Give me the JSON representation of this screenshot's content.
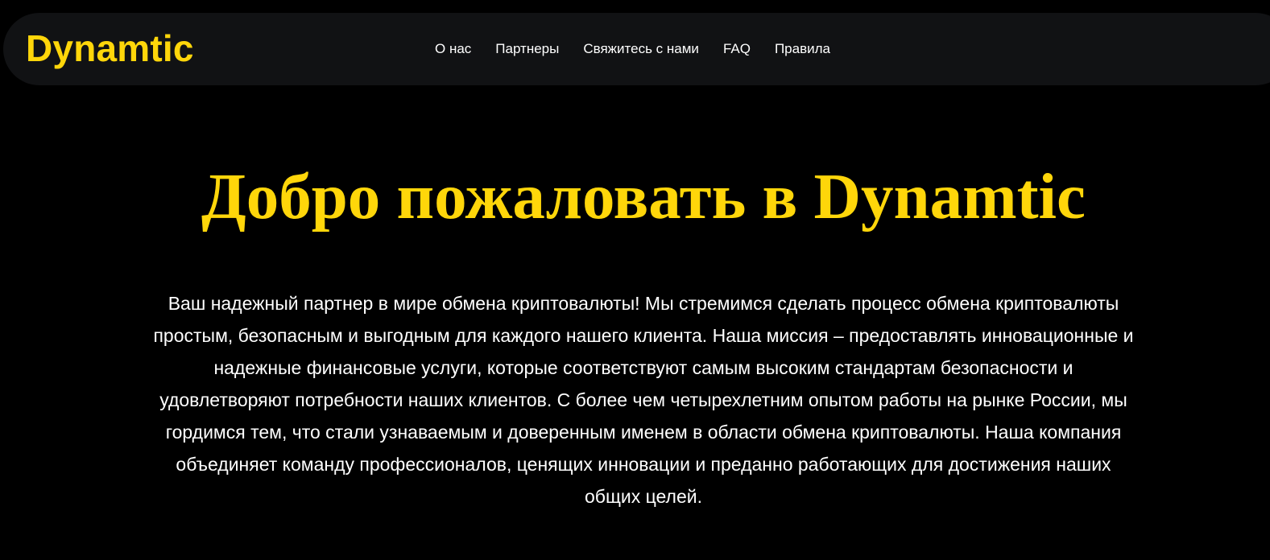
{
  "header": {
    "logo": "Dynamtic",
    "nav": [
      {
        "label": "О нас"
      },
      {
        "label": "Партнеры"
      },
      {
        "label": "Свяжитесь с нами"
      },
      {
        "label": "FAQ"
      },
      {
        "label": "Правила"
      }
    ]
  },
  "hero": {
    "title": "Добро пожаловать в Dynamtic",
    "text": "Ваш надежный партнер в мире обмена криптовалюты! Мы стремимся сделать процесс обмена криптовалюты простым, безопасным и выгодным для каждого нашего клиента. Наша миссия – предоставлять инновационные и надежные финансовые услуги, которые соответствуют самым высоким стандартам безопасности и удовлетворяют потребности наших клиентов. С более чем четырехлетним опытом работы на рынке России, мы гордимся тем, что стали узнаваемым и доверенным именем в области обмена криптовалюты. Наша компания объединяет команду профессионалов, ценящих инновации и преданно работающих для достижения наших общих целей."
  },
  "colors": {
    "accent": "#ffd60a",
    "background": "#000000",
    "navbar": "#111214",
    "text": "#ffffff"
  }
}
